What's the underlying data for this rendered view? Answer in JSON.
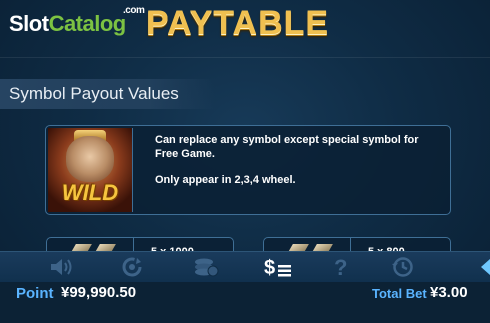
{
  "header": {
    "brand_part1": "Slot",
    "brand_part2": "Catalog",
    "brand_suffix": ".com",
    "title": "PAYTABLE"
  },
  "section": {
    "heading": "Symbol Payout Values"
  },
  "wild_symbol": {
    "symbol_text": "WILD",
    "description_line1": "Can replace any symbol except special symbol for Free Game.",
    "description_line2": "Only appear in 2,3,4 wheel."
  },
  "pay_cards": [
    {
      "text": "5 x 1000"
    },
    {
      "text": "5 x 800"
    }
  ],
  "toolbar": {
    "icons": [
      "sound-icon",
      "autoplay-icon",
      "coins-icon",
      "paytable-icon",
      "help-icon",
      "history-icon",
      "back-arrow-icon"
    ],
    "active_icon": "paytable-icon"
  },
  "footer": {
    "point_label": "Point",
    "point_value": "¥99,990.50",
    "total_bet_label": "Total Bet",
    "total_bet_value": "¥3.00"
  },
  "colors": {
    "accent_blue": "#5ab4ff",
    "title_gold": "#f0c050",
    "brand_green": "#7cc242",
    "card_border": "#3f6f96"
  }
}
